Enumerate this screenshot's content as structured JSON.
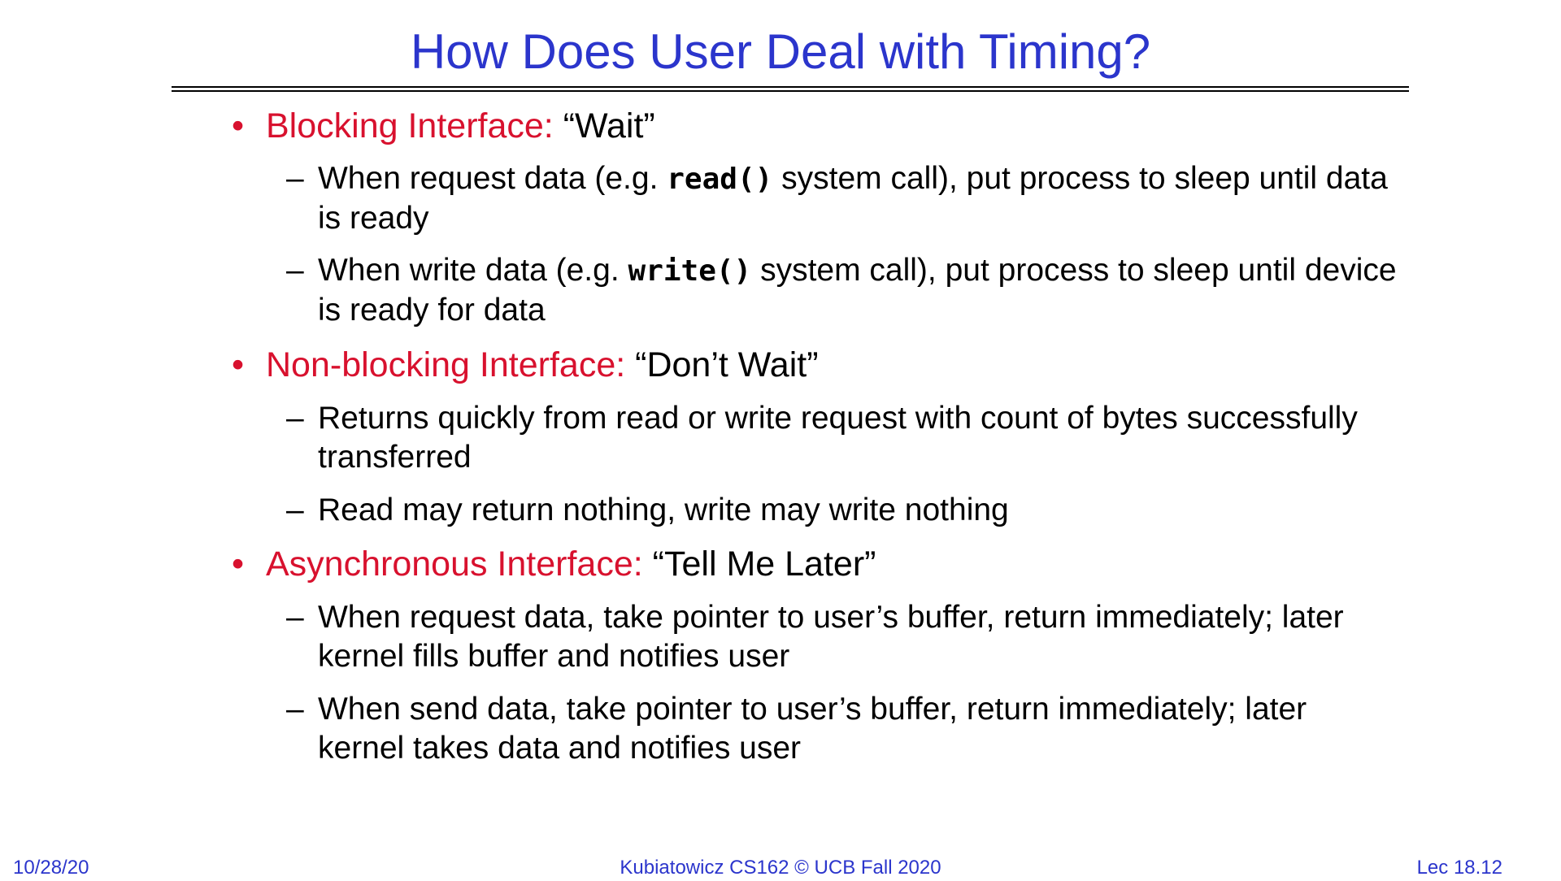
{
  "title": "How Does User Deal with Timing?",
  "bullets": [
    {
      "label": "Blocking Interface:",
      "quote": "“Wait”",
      "subs": [
        {
          "pre": "When request data (e.g. ",
          "code": "read()",
          "post": " system call), put process to sleep until data is ready"
        },
        {
          "pre": "When write data (e.g. ",
          "code": "write()",
          "post": " system call), put process to sleep until device is ready for data"
        }
      ]
    },
    {
      "label": "Non-blocking Interface:",
      "quote": "“Don’t Wait”",
      "subs": [
        {
          "text": "Returns quickly from read or write request with count of bytes successfully transferred"
        },
        {
          "text": "Read may return nothing, write may write nothing"
        }
      ]
    },
    {
      "label": "Asynchronous Interface:",
      "quote": "“Tell Me Later”",
      "subs": [
        {
          "text": "When request data, take pointer to user’s buffer, return immediately; later kernel fills buffer and notifies user"
        },
        {
          "text": "When send data, take pointer to user’s buffer, return immediately; later kernel takes data and notifies user"
        }
      ]
    }
  ],
  "footer": {
    "date": "10/28/20",
    "course": "Kubiatowicz CS162 © UCB Fall 2020",
    "lecture": "Lec 18.12"
  },
  "colors": {
    "title": "#2b35cc",
    "bullet_label": "#d8112e",
    "footer": "#2b35cc"
  }
}
